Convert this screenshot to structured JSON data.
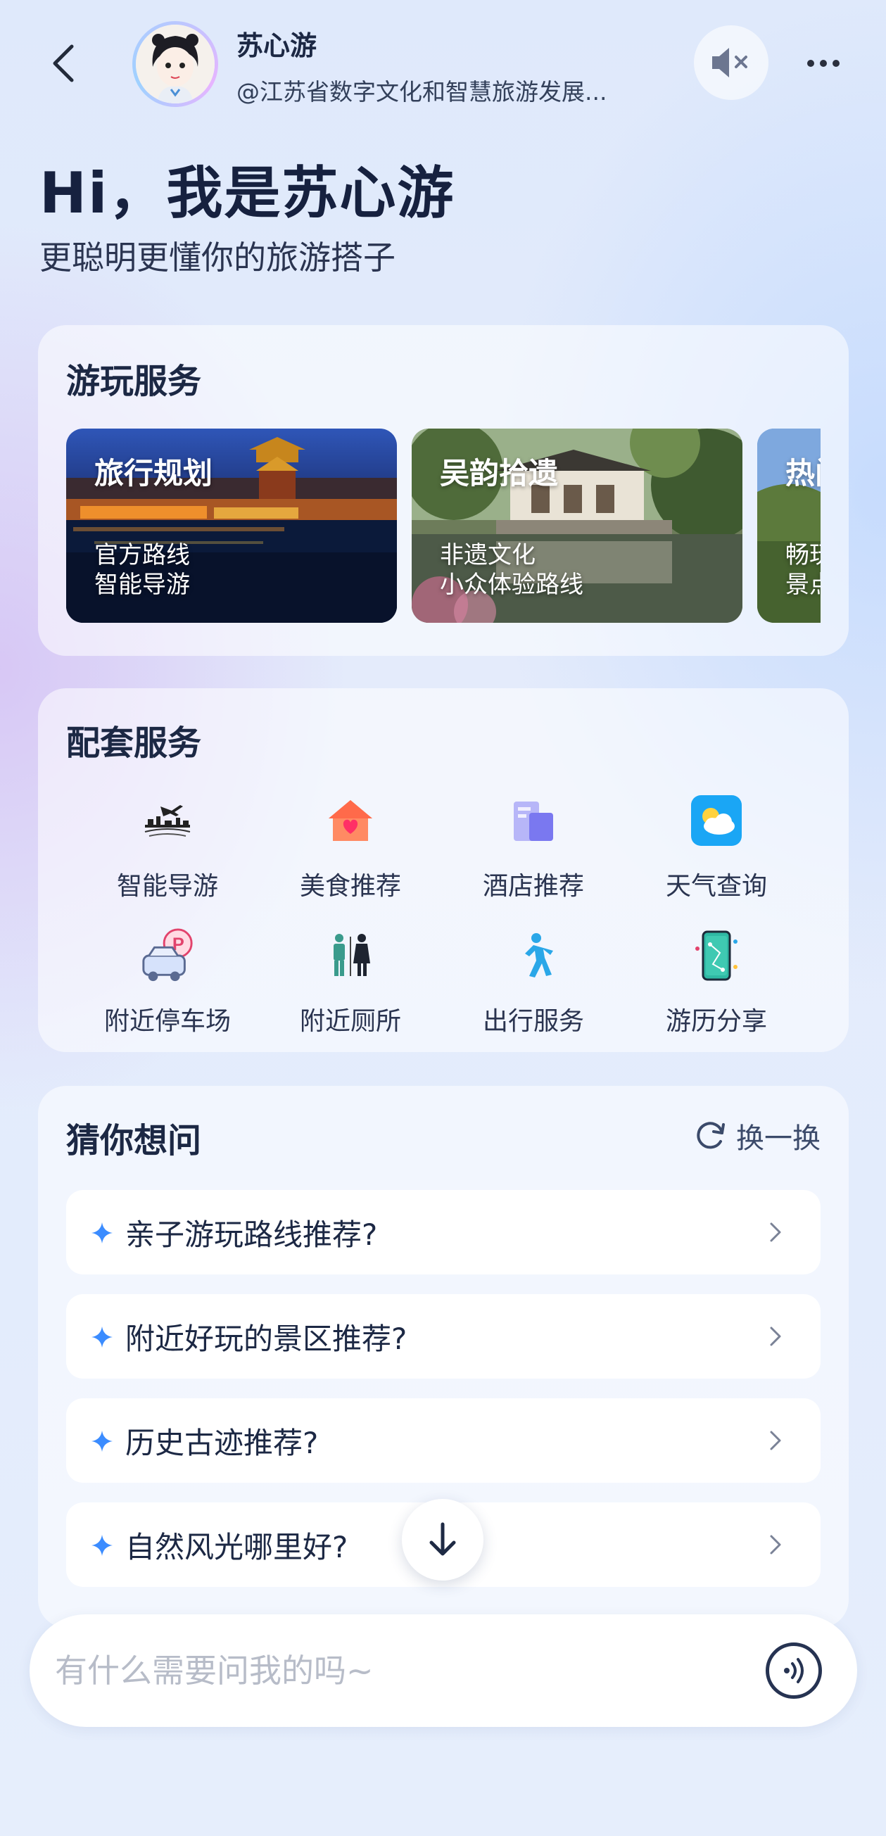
{
  "header": {
    "name": "苏心游",
    "subtitle": "@江苏省数字文化和智慧旅游发展...",
    "back_icon": "chevron-left-icon",
    "mute_icon": "speaker-muted-icon",
    "more_icon": "more-dots-icon"
  },
  "hero": {
    "title": "Hi，我是苏心游",
    "subtitle": "更聪明更懂你的旅游搭子"
  },
  "play_service": {
    "title": "游玩服务",
    "tiles": [
      {
        "title": "旅行规划",
        "line1": "官方路线",
        "line2": "智能导游"
      },
      {
        "title": "吴韵拾遗",
        "line1": "非遗文化",
        "line2": "小众体验路线"
      },
      {
        "title": "热门",
        "line1": "畅玩",
        "line2": "景点"
      }
    ]
  },
  "support_service": {
    "title": "配套服务",
    "items": [
      {
        "label": "智能导游",
        "icon": "travel-guide-icon"
      },
      {
        "label": "美食推荐",
        "icon": "food-house-icon"
      },
      {
        "label": "酒店推荐",
        "icon": "hotel-building-icon"
      },
      {
        "label": "天气查询",
        "icon": "weather-icon"
      },
      {
        "label": "附近停车场",
        "icon": "parking-icon"
      },
      {
        "label": "附近厕所",
        "icon": "restroom-icon"
      },
      {
        "label": "出行服务",
        "icon": "walking-person-icon"
      },
      {
        "label": "游历分享",
        "icon": "share-phone-icon"
      }
    ]
  },
  "guess": {
    "title": "猜你想问",
    "refresh_label": "换一换",
    "questions": [
      "亲子游玩路线推荐?",
      "附近好玩的景区推荐?",
      "历史古迹推荐?",
      "自然风光哪里好?"
    ]
  },
  "input": {
    "placeholder": "有什么需要问我的吗~",
    "value": ""
  },
  "colors": {
    "accent": "#3b8cff",
    "text_dark": "#1c2844"
  }
}
